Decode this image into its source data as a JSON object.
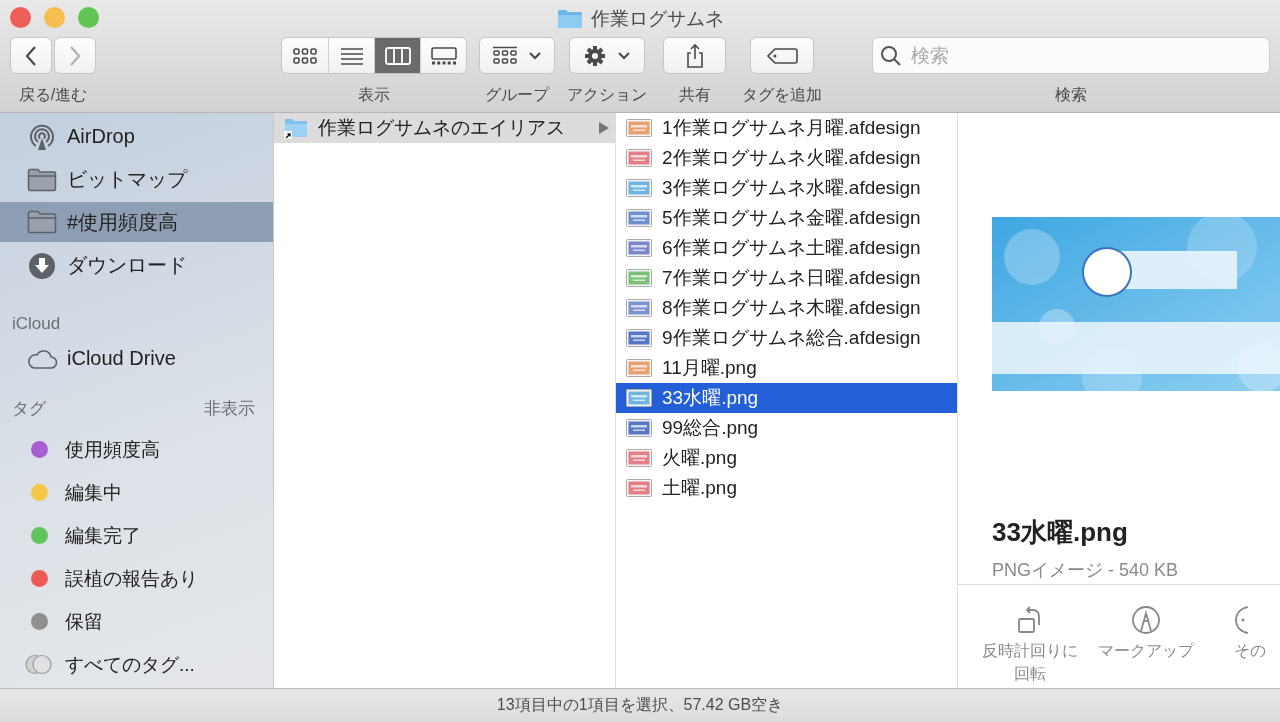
{
  "window": {
    "title": "作業ログサムネ"
  },
  "toolbar": {
    "nav": {
      "label": "戻る/進む",
      "buttons": [
        {
          "kind": "back",
          "disabled": false
        },
        {
          "kind": "forward",
          "disabled": true
        }
      ]
    },
    "view": {
      "label": "表示",
      "modes": [
        {
          "kind": "icons",
          "selected": false
        },
        {
          "kind": "list",
          "selected": false
        },
        {
          "kind": "columns",
          "selected": true
        },
        {
          "kind": "gallery",
          "selected": false
        }
      ]
    },
    "buttons": [
      {
        "kind": "group",
        "label": "グループ"
      },
      {
        "kind": "action",
        "label": "アクション"
      },
      {
        "kind": "share",
        "label": "共有"
      },
      {
        "kind": "tag",
        "label": "タグを追加"
      }
    ],
    "search": {
      "placeholder": "検索",
      "label": "検索"
    }
  },
  "sidebar": {
    "favorites": [
      {
        "kind": "airdrop",
        "label": "AirDrop",
        "selected": false
      },
      {
        "kind": "folder",
        "label": "ビットマップ",
        "selected": false
      },
      {
        "kind": "folder",
        "label": "#使用頻度高",
        "selected": true
      },
      {
        "kind": "download",
        "label": "ダウンロード",
        "selected": false
      }
    ],
    "icloud": {
      "heading": "iCloud",
      "items": [
        {
          "kind": "cloud",
          "label": "iCloud Drive",
          "selected": false
        }
      ]
    },
    "tags": {
      "heading": "タグ",
      "toggle": "非表示",
      "items": [
        {
          "kind": "tag",
          "label": "使用頻度高",
          "color": "#a95fd4"
        },
        {
          "kind": "tag",
          "label": "編集中",
          "color": "#f6c646"
        },
        {
          "kind": "tag",
          "label": "編集完了",
          "color": "#5fc55b"
        },
        {
          "kind": "tag",
          "label": "誤植の報告あり",
          "color": "#ec5a55"
        },
        {
          "kind": "tag",
          "label": "保留",
          "color": "#8f8f8f"
        },
        {
          "kind": "all",
          "label": "すべてのタグ..."
        }
      ]
    }
  },
  "columns": [
    {
      "focused": false,
      "items": [
        {
          "kind": "alias",
          "name": "作業ログサムネのエイリアス",
          "selected": true
        }
      ]
    },
    {
      "focused": true,
      "items": [
        {
          "kind": "file",
          "name": "1作業ログサムネ月曜.afdesign",
          "color": "#e9a070",
          "selected": false
        },
        {
          "kind": "file",
          "name": "2作業ログサムネ火曜.afdesign",
          "color": "#e57f85",
          "selected": false
        },
        {
          "kind": "file",
          "name": "3作業ログサムネ水曜.afdesign",
          "color": "#6fb5e0",
          "selected": false
        },
        {
          "kind": "file",
          "name": "5作業ログサムネ金曜.afdesign",
          "color": "#6f8fd0",
          "selected": false
        },
        {
          "kind": "file",
          "name": "6作業ログサムネ土曜.afdesign",
          "color": "#7a88c8",
          "selected": false
        },
        {
          "kind": "file",
          "name": "7作業ログサムネ日曜.afdesign",
          "color": "#7cc07a",
          "selected": false
        },
        {
          "kind": "file",
          "name": "8作業ログサムネ木曜.afdesign",
          "color": "#7c92cc",
          "selected": false
        },
        {
          "kind": "file",
          "name": "9作業ログサムネ総合.afdesign",
          "color": "#5577c4",
          "selected": false
        },
        {
          "kind": "file",
          "name": "11月曜.png",
          "color": "#e9a070",
          "selected": false
        },
        {
          "kind": "file",
          "name": "33水曜.png",
          "color": "#6fb5e0",
          "selected": true
        },
        {
          "kind": "file",
          "name": "99総合.png",
          "color": "#5577c4",
          "selected": false
        },
        {
          "kind": "file",
          "name": "火曜.png",
          "color": "#e57f85",
          "selected": false
        },
        {
          "kind": "file",
          "name": "土曜.png",
          "color": "#e57f85",
          "selected": false
        }
      ]
    }
  ],
  "preview": {
    "name": "33水曜.png",
    "info": "PNGイメージ - 540 KB",
    "actions": [
      {
        "kind": "rotate",
        "label": "反時計回りに回転"
      },
      {
        "kind": "markup",
        "label": "マークアップ"
      },
      {
        "kind": "more",
        "label": "その"
      }
    ]
  },
  "status_bar": "13項目中の1項目を選択、57.42 GB空き"
}
